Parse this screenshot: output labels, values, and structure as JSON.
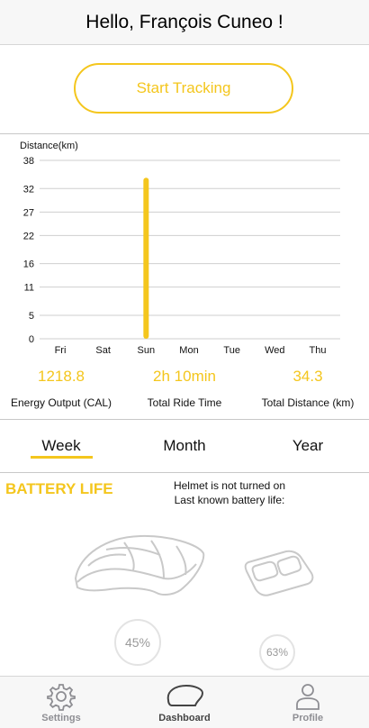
{
  "header": {
    "title": "Hello, François Cuneo !"
  },
  "start_tracking": {
    "label": "Start Tracking"
  },
  "chart_data": {
    "type": "bar",
    "ylabel": "Distance(km)",
    "categories": [
      "Fri",
      "Sat",
      "Sun",
      "Mon",
      "Tue",
      "Wed",
      "Thu"
    ],
    "values": [
      0,
      0,
      34.3,
      0,
      0,
      0,
      0
    ],
    "yticks": [
      0,
      5,
      11,
      16,
      22,
      27,
      32,
      38
    ],
    "ylim": [
      0,
      38
    ],
    "bar_color": "#f4c61d",
    "grid": true
  },
  "stats": [
    {
      "value": "1218.8",
      "label": "Energy Output (CAL)"
    },
    {
      "value": "2h 10min",
      "label": "Total Ride Time"
    },
    {
      "value": "34.3",
      "label": "Total Distance (km)"
    }
  ],
  "period_tabs": {
    "week": "Week",
    "month": "Month",
    "year": "Year",
    "selected": "Week"
  },
  "battery": {
    "title": "BATTERY LIFE",
    "message_line1": "Helmet is not turned on",
    "message_line2": "Last known battery life:",
    "helmet_percent": "45%",
    "remote_percent": "63%"
  },
  "tabbar": {
    "settings": "Settings",
    "dashboard": "Dashboard",
    "profile": "Profile",
    "active": "Dashboard"
  },
  "colors": {
    "accent": "#f4c61d",
    "muted": "#8e8e93"
  }
}
